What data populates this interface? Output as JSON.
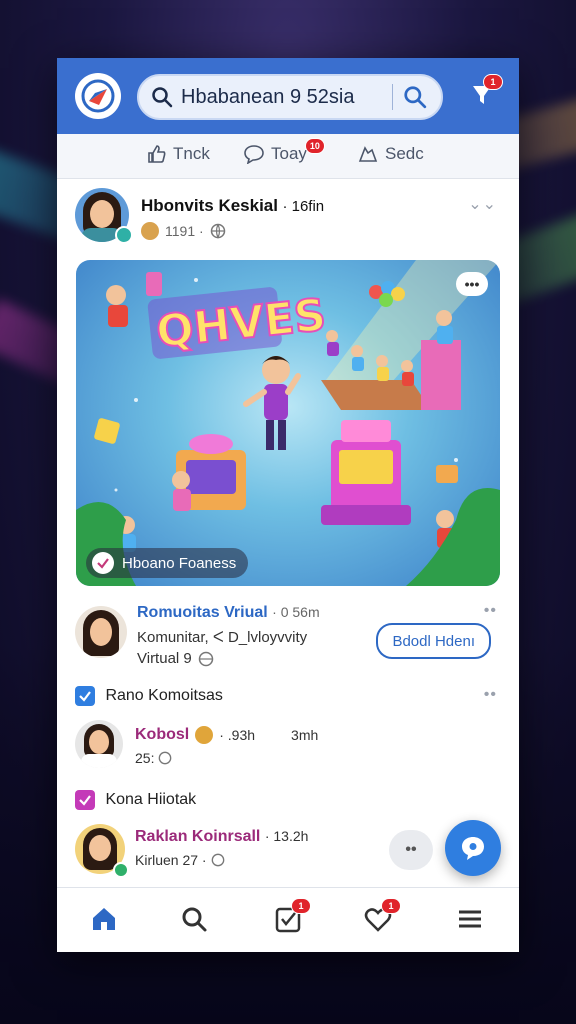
{
  "header": {
    "search_text": "Hbabanean 9 52sia",
    "notification_badge": "1"
  },
  "tabs": [
    {
      "label": "Tnck",
      "icon": "thumbs-up-icon"
    },
    {
      "label": "Toay",
      "icon": "chat-bubble-icon",
      "badge": "10"
    },
    {
      "label": "Sedc",
      "icon": "share-icon"
    }
  ],
  "post": {
    "author": "Hbonvits Keskial",
    "time": "· 16fin",
    "meta": "1191 ·",
    "hero_caption": "Hboano Foaness",
    "hero_sign": "QHVES"
  },
  "community": {
    "name": "Romuoitas Vriual",
    "time": "· 0 56m",
    "line2": "Komunitar,  ᐸ D_lvloyvvity",
    "line3": "Virtual 9",
    "button_label": "Bdodl Hdenı"
  },
  "section1": {
    "label": "Rano Komoitsas"
  },
  "comment1": {
    "name": "Kobosl",
    "time": "· .93h",
    "time2": "3mh",
    "meta": "25:"
  },
  "section2": {
    "label": "Kona Hiiotak"
  },
  "comment2": {
    "name": "Raklan Koinrsall",
    "time": "· 13.2h",
    "meta": "Kirluen 27 ·"
  },
  "fab2_label": "••",
  "bottom_nav": [
    {
      "icon": "home-icon"
    },
    {
      "icon": "search-icon"
    },
    {
      "icon": "checkbox-icon",
      "badge": "1"
    },
    {
      "icon": "heart-icon",
      "badge": "1"
    },
    {
      "icon": "menu-icon"
    }
  ],
  "colors": {
    "brand": "#3a6fcf",
    "accent": "#2f7ee0",
    "badge": "#e0242b",
    "purple": "#9b2a7a"
  }
}
